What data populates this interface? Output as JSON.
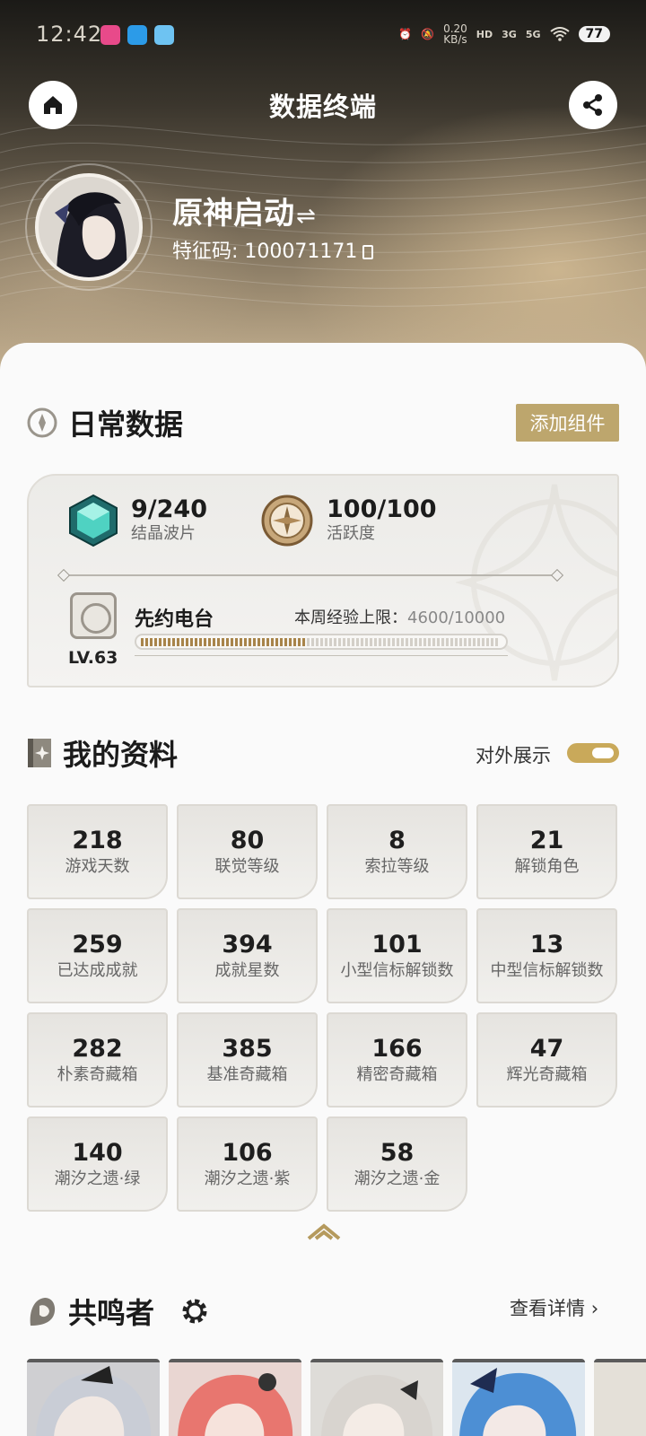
{
  "status_bar": {
    "time": "12:42",
    "speed_value": "0.20",
    "speed_unit": "KB/s",
    "network_1": "HD",
    "network_2": "3G",
    "network_3": "5G",
    "battery": "77"
  },
  "header": {
    "title": "数据终端",
    "user_name": "原神启动",
    "user_id": "特征码: 100071171"
  },
  "daily": {
    "title": "日常数据",
    "add_widget_label": "添加组件",
    "crystal_value": "9/240",
    "crystal_label": "结晶波片",
    "activity_value": "100/100",
    "activity_label": "活跃度",
    "radio_name": "先约电台",
    "radio_level": "LV.63",
    "weekly_label": "本周经验上限：",
    "weekly_value": "4600/10000",
    "weekly_progress": 0.46
  },
  "profile": {
    "title": "我的资料",
    "public_label": "对外展示",
    "public_on": true,
    "stats": [
      {
        "value": "218",
        "label": "游戏天数"
      },
      {
        "value": "80",
        "label": "联觉等级"
      },
      {
        "value": "8",
        "label": "索拉等级"
      },
      {
        "value": "21",
        "label": "解锁角色"
      },
      {
        "value": "259",
        "label": "已达成成就"
      },
      {
        "value": "394",
        "label": "成就星数"
      },
      {
        "value": "101",
        "label": "小型信标解锁数"
      },
      {
        "value": "13",
        "label": "中型信标解锁数"
      },
      {
        "value": "282",
        "label": "朴素奇藏箱"
      },
      {
        "value": "385",
        "label": "基准奇藏箱"
      },
      {
        "value": "166",
        "label": "精密奇藏箱"
      },
      {
        "value": "47",
        "label": "辉光奇藏箱"
      },
      {
        "value": "140",
        "label": "潮汐之遗·绿"
      },
      {
        "value": "106",
        "label": "潮汐之遗·紫"
      },
      {
        "value": "58",
        "label": "潮汐之遗·金"
      }
    ]
  },
  "resonators": {
    "title": "共鸣者",
    "view_details_label": "查看详情"
  },
  "colors": {
    "accent_gold": "#bda66d",
    "progress_fill": "#a8844a"
  }
}
